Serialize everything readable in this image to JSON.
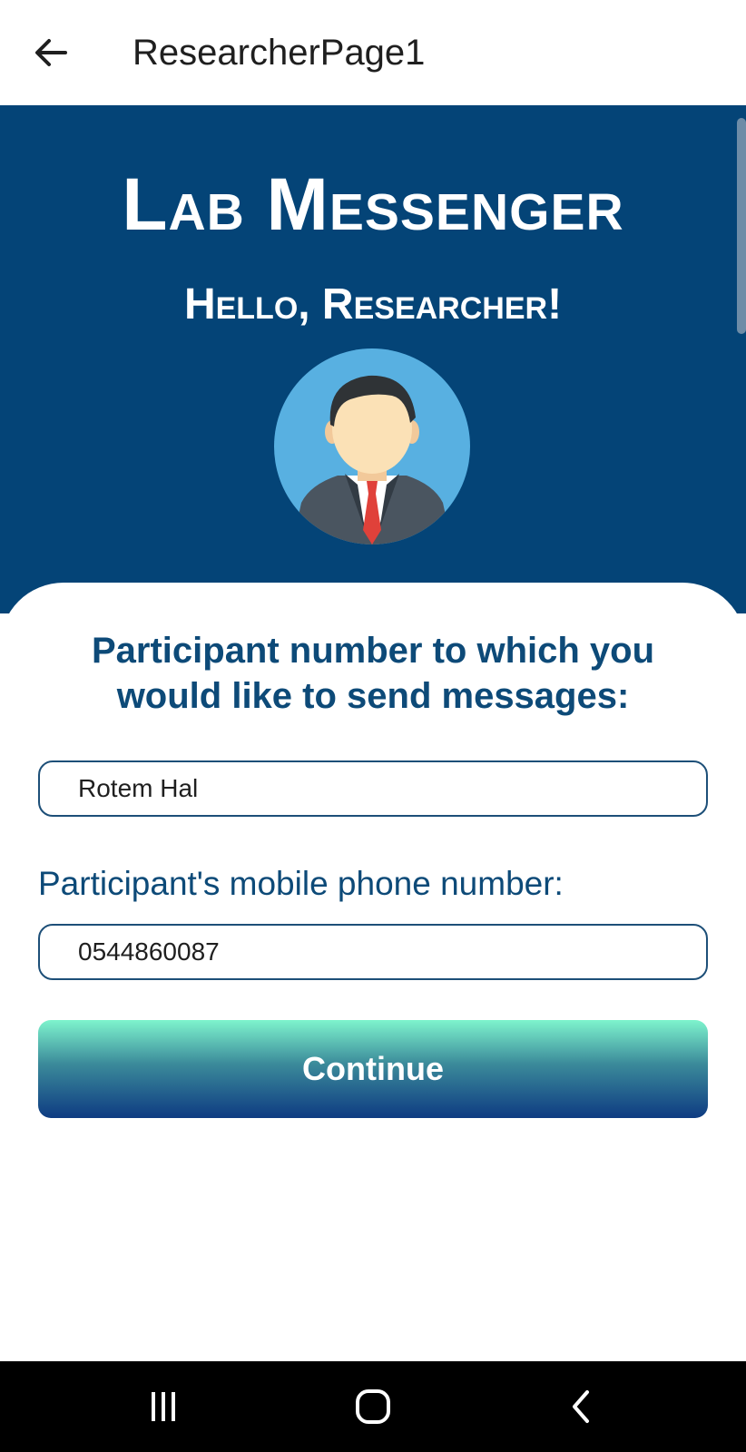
{
  "appbar": {
    "title": "ResearcherPage1",
    "back_icon": "arrow-left-icon"
  },
  "hero": {
    "app_name": "Lab Messenger",
    "greeting": "Hello, Researcher!",
    "background_color": "#044477",
    "avatar_icon": "researcher-avatar-icon"
  },
  "form": {
    "prompt": "Participant number to which you would like to send messages:",
    "participant_value": "Rotem Hal",
    "phone_label": "Participant's mobile phone number:",
    "phone_value": "0544860087",
    "continue_label": "Continue",
    "text_color": "#0d4a78"
  },
  "system_nav": {
    "recents_icon": "recents-icon",
    "home_icon": "home-icon",
    "back_icon": "chevron-left-icon"
  }
}
